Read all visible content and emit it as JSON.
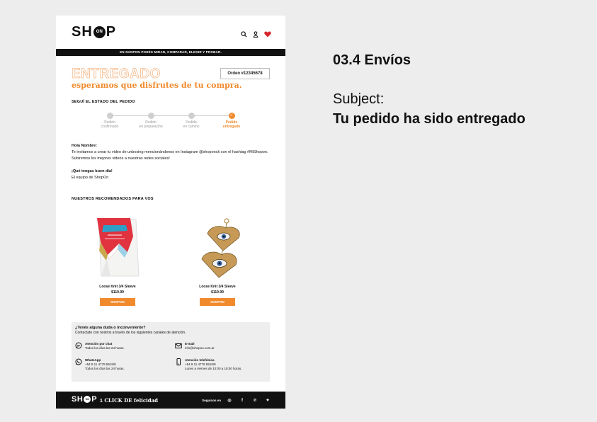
{
  "section_title": "03.4 Envíos",
  "subject_label": "Subject:",
  "subject_value": "Tu pedido ha sido entregado",
  "email": {
    "logo": {
      "left": "SH",
      "circle": "ON",
      "right": "P"
    },
    "header_icons": [
      "search-icon",
      "user-icon",
      "heart-icon"
    ],
    "promo_bar": "EN SHOPON PODÉS MIRAR, COMPARAR, ELEGIR Y PROBAR.",
    "status_word": "ENTREGADO",
    "status_sub": "esperamos que disfrutes de tu compra.",
    "order": "Orden  #12345678",
    "tracking": {
      "title": "SEGUÍ EL ESTADO DEL PEDIDO",
      "steps": [
        {
          "line1": "Pedido",
          "line2": "confirmado",
          "active": false
        },
        {
          "line1": "Pedido",
          "line2": "en preparación",
          "active": false
        },
        {
          "line1": "Pedido",
          "line2": "en camino",
          "active": false
        },
        {
          "line1": "Pedido",
          "line2": "entregado",
          "active": true
        }
      ],
      "check": "✓"
    },
    "message": {
      "greeting": "Hola Nombre:",
      "body": "Te invitamos a crear tu video de unboxing mencionándonos en Instagram @shoponck con el hashtag #MiShopon. Subiremos los mejores videos a nuestras redes sociales!",
      "closing": "¡Qué tengas buen día!",
      "signature": "El equipo de ShopOn"
    },
    "recommended": {
      "title": "NUESTROS RECOMENDADOS PARA VOS",
      "products": [
        {
          "name": "Loose Knit 3/4 Sleeve",
          "price": "$119.99",
          "button": "SHOPON",
          "image": "scarf-bag-image"
        },
        {
          "name": "Loose Knit 3/4 Sleeve",
          "price": "$119.99",
          "button": "SHOPON",
          "image": "eye-earrings-image"
        }
      ]
    },
    "help": {
      "question": "¿Tenés alguna duda o inconveniente?",
      "sub": "Contactate con nostros a través de los siguientes canales de atención.",
      "channels": [
        {
          "icon": "chat-icon",
          "title": "Atención por chat",
          "line1": "Todos los días las 24 horas.",
          "line2": ""
        },
        {
          "icon": "mail-icon",
          "title": "E-mail",
          "line1": "info@shopon.com.ar",
          "line2": ""
        },
        {
          "icon": "whatsapp-icon",
          "title": "WhatsApp",
          "line1": "+54 9 11 4778 5515/8",
          "line2": "Todos los días las 24 horas."
        },
        {
          "icon": "phone-icon",
          "title": "Atención telefónica",
          "line1": "+54 9 11 4778 5515/8",
          "line2": "Lunes a viernes de 10:00 a 18:00 horas."
        }
      ]
    },
    "footer": {
      "logo": {
        "left": "SH",
        "circle": "ON",
        "right": "P"
      },
      "tag_number": "1",
      "tag_text": " CLICK DE felicidad",
      "follow": "Seguinos en",
      "social": [
        "instagram-icon",
        "facebook-icon",
        "pinterest-icon",
        "twitter-icon"
      ],
      "social_glyphs": [
        "◎",
        "f",
        "℗",
        "✦"
      ]
    }
  }
}
